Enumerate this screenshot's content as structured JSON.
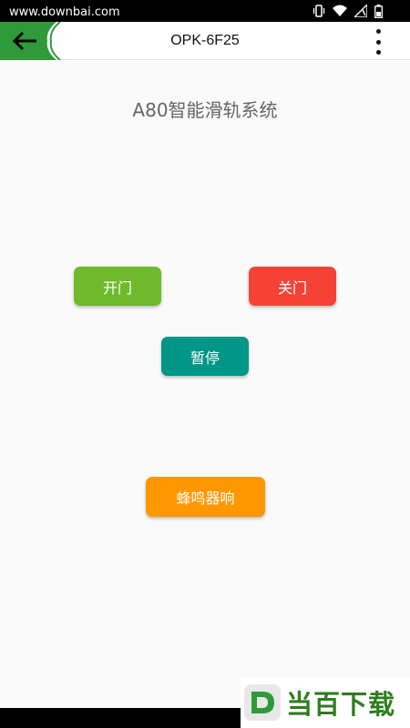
{
  "status_bar": {
    "watermark": "www.downbai.com",
    "icons": [
      "vibrate-icon",
      "wifi-icon",
      "signal-icon",
      "battery-icon"
    ]
  },
  "app_bar": {
    "title": "OPK-6F25",
    "back_icon": "back-arrow-icon",
    "menu_icon": "more-vertical-icon"
  },
  "main": {
    "heading": "A80智能滑轨系统",
    "buttons": {
      "open": "开门",
      "close": "关门",
      "pause": "暂停",
      "buzzer": "蜂鸣器响"
    }
  },
  "watermark_bottom": {
    "text": "当百下载",
    "logo_letter": "D"
  },
  "colors": {
    "accent_green": "#2e9a3a",
    "open": "#6fba2c",
    "close": "#f44336",
    "pause": "#009688",
    "buzzer": "#ff9800",
    "heading": "#666666"
  }
}
